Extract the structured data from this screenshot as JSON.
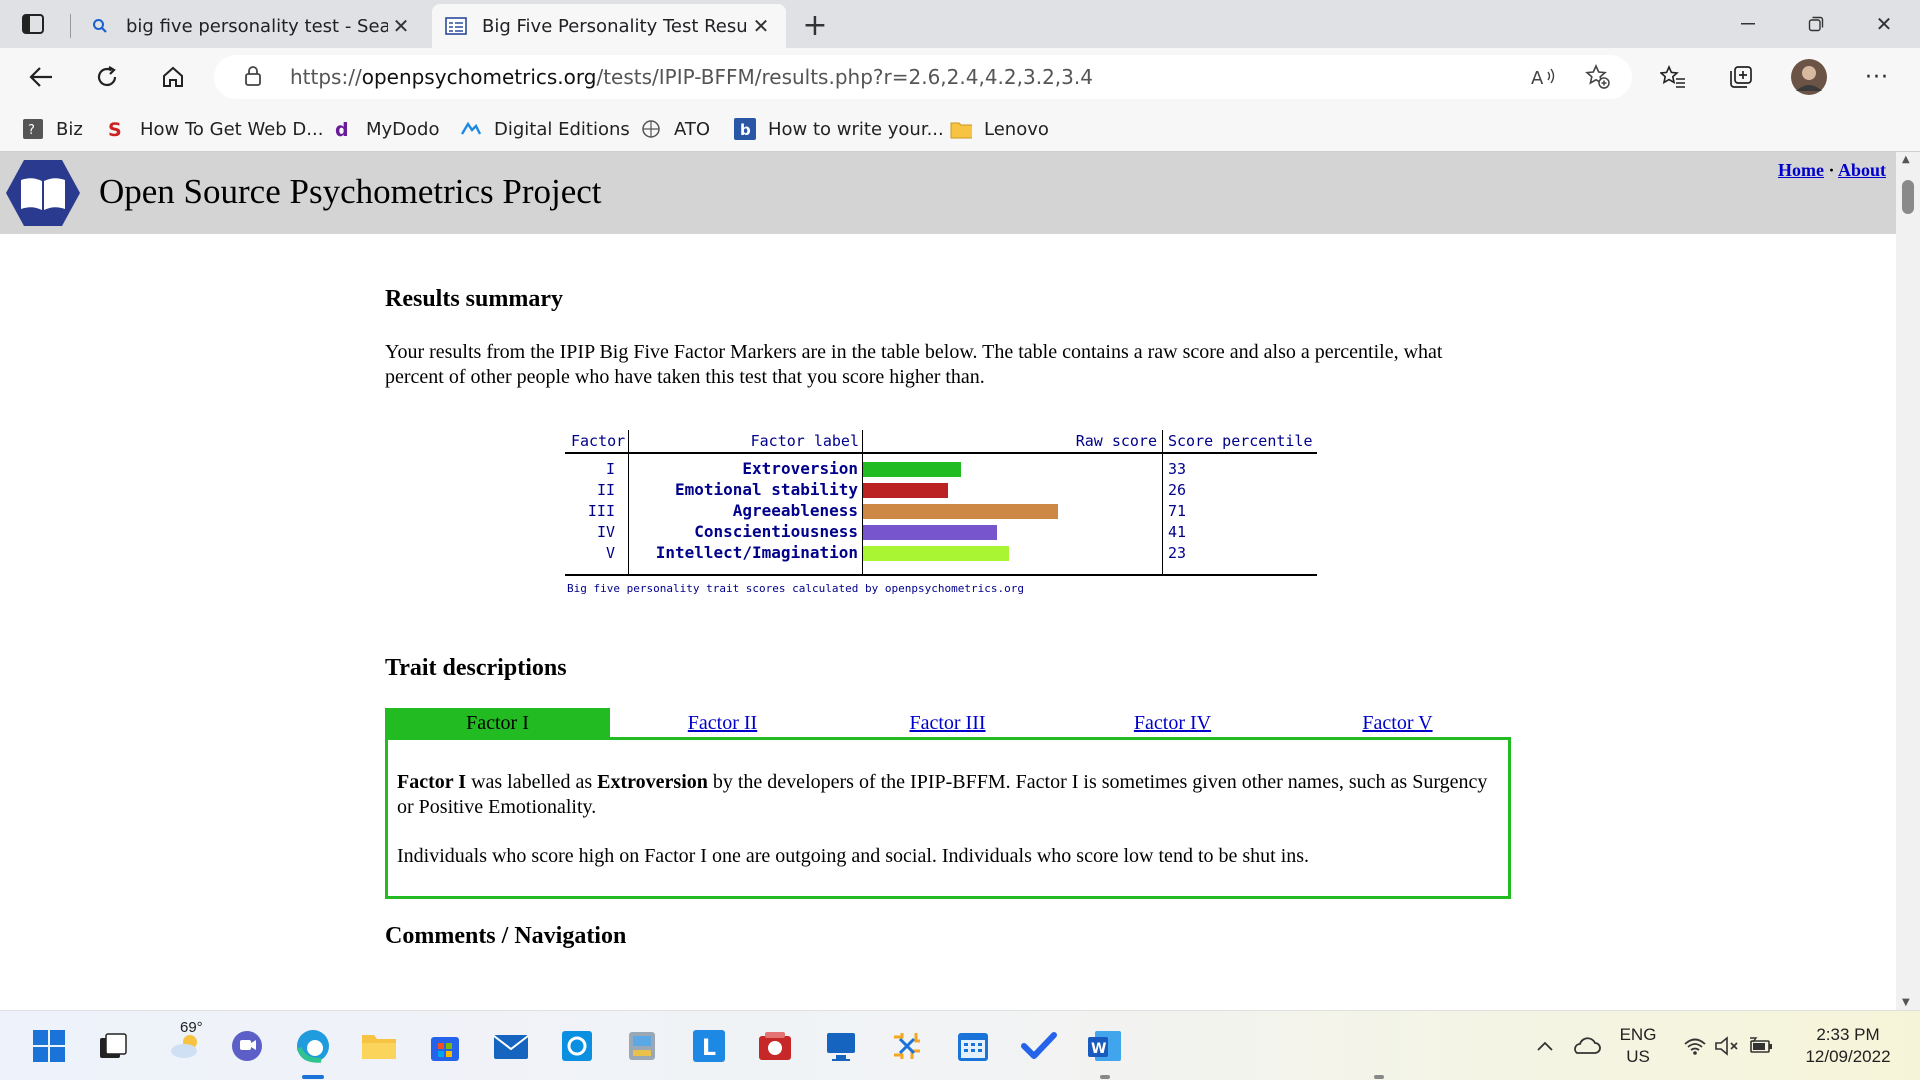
{
  "browser": {
    "tabs": [
      {
        "title": "big five personality test - Search",
        "icon": "search-icon"
      },
      {
        "title": "Big Five Personality Test Results",
        "icon": "page-icon"
      }
    ],
    "url_prefix": "https://",
    "url_domain": "openpsychometrics.org",
    "url_path": "/tests/IPIP-BFFM/results.php?r=2.6,2.4,4.2,3.2,3.4",
    "bookmarks": [
      {
        "label": "Biz"
      },
      {
        "label": "How To Get Web D..."
      },
      {
        "label": "MyDodo"
      },
      {
        "label": "Digital Editions"
      },
      {
        "label": "ATO"
      },
      {
        "label": "How to write your..."
      },
      {
        "label": "Lenovo"
      }
    ]
  },
  "site": {
    "title": "Open Source Psychometrics Project",
    "nav_home": "Home",
    "nav_sep": "·",
    "nav_about": "About"
  },
  "summary": {
    "heading": "Results summary",
    "text": "Your results from the IPIP Big Five Factor Markers are in the table below. The table contains a raw score and also a percentile, what percent of other people who have taken this test that you score higher than."
  },
  "results_table": {
    "headers": {
      "factor": "Factor",
      "label": "Factor label",
      "raw": "Raw score",
      "percentile": "Score percentile"
    },
    "rows": [
      {
        "factor": "I",
        "label": "Extroversion",
        "raw_fraction": 0.4,
        "color": "#22bb22",
        "percentile": "33"
      },
      {
        "factor": "II",
        "label": "Emotional stability",
        "raw_fraction": 0.35,
        "color": "#bb2222",
        "percentile": "26"
      },
      {
        "factor": "III",
        "label": "Agreeableness",
        "raw_fraction": 0.8,
        "color": "#cc8844",
        "percentile": "71"
      },
      {
        "factor": "IV",
        "label": "Conscientiousness",
        "raw_fraction": 0.55,
        "color": "#7755cc",
        "percentile": "41"
      },
      {
        "factor": "V",
        "label": "Intellect/Imagination",
        "raw_fraction": 0.6,
        "color": "#aaf533",
        "percentile": "23"
      }
    ],
    "caption": "Big five personality trait scores calculated by openpsychometrics.org"
  },
  "traits": {
    "heading": "Trait descriptions",
    "tabs": [
      "Factor I",
      "Factor II",
      "Factor III",
      "Factor IV",
      "Factor V"
    ],
    "p1_bold_factor": "Factor I",
    "p1_mid": " was labelled as ",
    "p1_bold_name": "Extroversion",
    "p1_rest": " by the developers of the IPIP-BFFM. Factor I is sometimes given other names, such as Surgency or Positive Emotionality.",
    "p2": "Individuals who score high on Factor I one are outgoing and social. Individuals who score low tend to be shut ins."
  },
  "comments": {
    "heading": "Comments / Navigation"
  },
  "taskbar": {
    "weather_temp": "69°",
    "lang_top": "ENG",
    "lang_bottom": "US",
    "time": "2:33 PM",
    "date": "12/09/2022"
  }
}
